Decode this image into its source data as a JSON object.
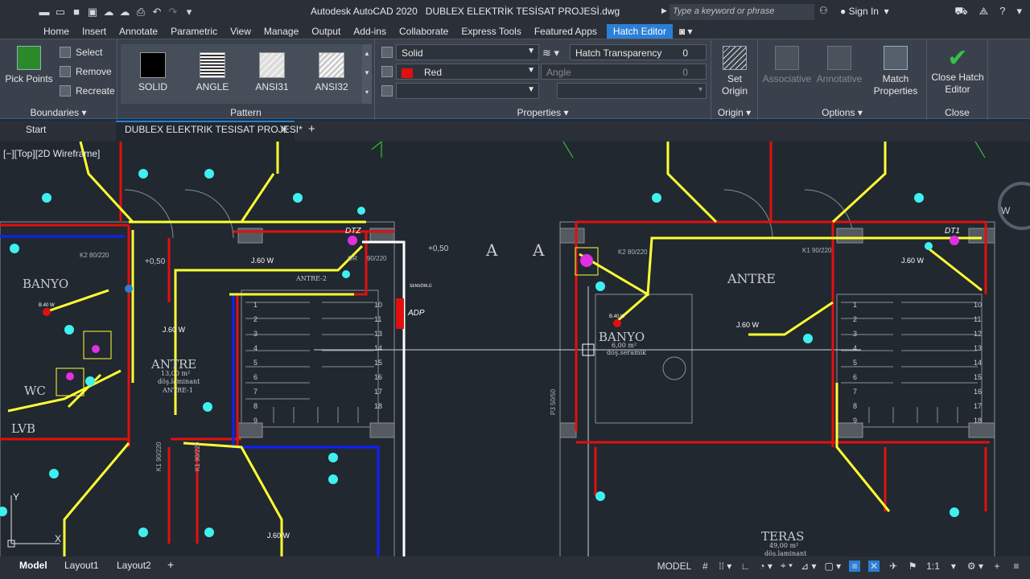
{
  "window": {
    "title": "Autodesk AutoCAD 2020",
    "document": "DUBLEX ELEKTRİK TESİSAT PROJESİ.dwg",
    "search_placeholder": "Type a keyword or phrase",
    "sign_in": "Sign In"
  },
  "ribbon_tabs": [
    "Home",
    "Insert",
    "Annotate",
    "Parametric",
    "View",
    "Manage",
    "Output",
    "Add-ins",
    "Collaborate",
    "Express Tools",
    "Featured Apps",
    "Hatch Editor"
  ],
  "ribbon": {
    "boundaries": {
      "pick_points": "Pick Points",
      "select": "Select",
      "remove": "Remove",
      "recreate": "Recreate",
      "label": "Boundaries"
    },
    "pattern": {
      "swatches": [
        "SOLID",
        "ANGLE",
        "ANSI31",
        "ANSI32"
      ],
      "label": "Pattern"
    },
    "properties": {
      "hatch_type": "Solid",
      "color": "Red",
      "color_hex": "#e01010",
      "hatch_transparency_label": "Hatch Transparency",
      "transparency_value": "0",
      "angle_label": "Angle",
      "angle_value": "0",
      "label": "Properties"
    },
    "origin": {
      "set_origin": "Set Origin",
      "label": "Origin"
    },
    "options": {
      "associative": "Associative",
      "annotative": "Annotative",
      "match_properties": "Match Properties",
      "label": "Options"
    },
    "close": {
      "close_hatch_editor": "Close Hatch Editor",
      "label": "Close"
    }
  },
  "doc_tabs": {
    "start": "Start",
    "active": "DUBLEX ELEKTRIK TESISAT PROJESI*"
  },
  "viewport_label": "[−][Top][2D Wireframe]",
  "drawing_labels": {
    "banyo_left": "BANYO",
    "antre_left": "ANTRE",
    "antre_left_area": "13,00 m²",
    "antre_left_floor": "döş.laminant",
    "antre_left_code": "ANTRE-1",
    "antre2": "ANTRE-2",
    "wc": "WC",
    "lvb": "LVB",
    "dtz_left": "DTZ",
    "dt1_right": "DT1",
    "adp": "ADP",
    "sensor": "SENSÖRLÜ",
    "plus050_a": "+0,50",
    "plus050_b": "+0,50",
    "a1": "A",
    "a2": "A",
    "antre_right": "ANTRE",
    "banyo_right": "BANYO",
    "banyo_right_area": "6,00 m²",
    "banyo_right_floor": "döş.seramik",
    "teras": "TERAS",
    "teras_area": "49,00 m²",
    "teras_floor": "döş.laminant",
    "j60_a": "J.60 W",
    "j60_b": "J.60 W",
    "j60_c": "J.60 W",
    "j60_d": "J.60 W",
    "j60_e": "J.60 W",
    "b40_a": "B.40 W",
    "b40_b": "B.40 W",
    "k2_left": "K2 80/220",
    "k2_right": "K2 80/220",
    "k1_right": "K1 90/220",
    "gr": "GR",
    "gr_size": "90/220",
    "k1_a": "K1 90/220",
    "k1_b": "K1 90/220",
    "p3": "P3 50/50",
    "stair_numbers_left": [
      "1",
      "2",
      "3",
      "4",
      "5",
      "6",
      "7",
      "8",
      "9",
      "10",
      "11",
      "13",
      "14",
      "15",
      "16",
      "17",
      "18"
    ],
    "stair_numbers_right": [
      "1",
      "2",
      "3",
      "4",
      "5",
      "6",
      "7",
      "8",
      "9",
      "10",
      "11",
      "12",
      "13",
      "14",
      "15",
      "16",
      "17",
      "18"
    ]
  },
  "status_bar": {
    "layouts": [
      "Model",
      "Layout1",
      "Layout2"
    ],
    "model": "MODEL",
    "scale": "1:1"
  },
  "colors": {
    "wire_yellow": "#ffff33",
    "wire_red": "#e01010",
    "wire_blue": "#1020ff",
    "symbol_cyan": "#40f0f0",
    "symbol_magenta": "#e030e0",
    "accent": "#2b7fd6"
  }
}
